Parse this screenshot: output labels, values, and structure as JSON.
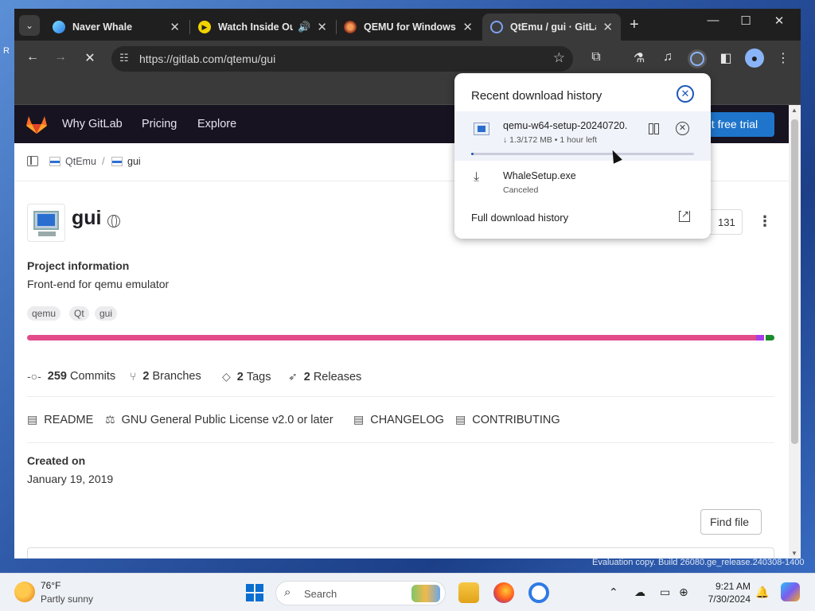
{
  "browser": {
    "tabs": [
      {
        "title": "Naver Whale",
        "icon": "whale-icon"
      },
      {
        "title": "Watch Inside Ou",
        "icon": "play-icon"
      },
      {
        "title": "QEMU for Windows",
        "icon": "qemu-icon"
      },
      {
        "title": "QtEmu / gui · GitLab",
        "icon": "gitlab-icon",
        "active": true
      }
    ],
    "url": "https://gitlab.com/qtemu/gui"
  },
  "gitlab_nav": {
    "links": [
      "Why GitLab",
      "Pricing",
      "Explore"
    ],
    "trial_button": "et free trial"
  },
  "breadcrumb": {
    "group": "QtEmu",
    "separator": "/",
    "project": "gui"
  },
  "project": {
    "name": "gui",
    "star_count": "131",
    "info_heading": "Project information",
    "description": "Front-end for qemu emulator",
    "topics": [
      "qemu",
      "Qt",
      "gui"
    ],
    "languages": [
      {
        "color": "#e24c8a",
        "fraction": 0.975
      },
      {
        "color": "#a83ce6",
        "fraction": 0.011
      },
      {
        "color": "#ffffff",
        "fraction": 0.002
      },
      {
        "color": "#1a8a2a",
        "fraction": 0.012
      }
    ],
    "stats": [
      {
        "count": "259",
        "label": "Commits",
        "icon": "commit-icon"
      },
      {
        "count": "2",
        "label": "Branches",
        "icon": "branch-icon"
      },
      {
        "count": "2",
        "label": "Tags",
        "icon": "tag-icon"
      },
      {
        "count": "2",
        "label": "Releases",
        "icon": "rocket-icon"
      }
    ],
    "docs": [
      "README",
      "GNU General Public License v2.0 or later",
      "CHANGELOG",
      "CONTRIBUTING"
    ],
    "created_heading": "Created on",
    "created_date": "January 19, 2019",
    "find_file": "Find file"
  },
  "downloads": {
    "title": "Recent download history",
    "items": [
      {
        "name": "qemu-w64-setup-20240720.",
        "meta": "↓ 1.3/172 MB • 1 hour left",
        "progress": 0.0076
      },
      {
        "name": "WhaleSetup.exe",
        "meta": "Canceled"
      }
    ],
    "full_history": "Full download history"
  },
  "watermark": "Evaluation copy. Build 26080.ge_release.240308-1400",
  "taskbar": {
    "weather_temp": "76°F",
    "weather_desc": "Partly sunny",
    "search_label": "Search",
    "time": "9:21 AM",
    "date": "7/30/2024"
  },
  "colors": {
    "gitlab_nav_bg": "#171321",
    "trial_button": "#1f75cb",
    "browser_chrome": "#3a3a3a"
  }
}
